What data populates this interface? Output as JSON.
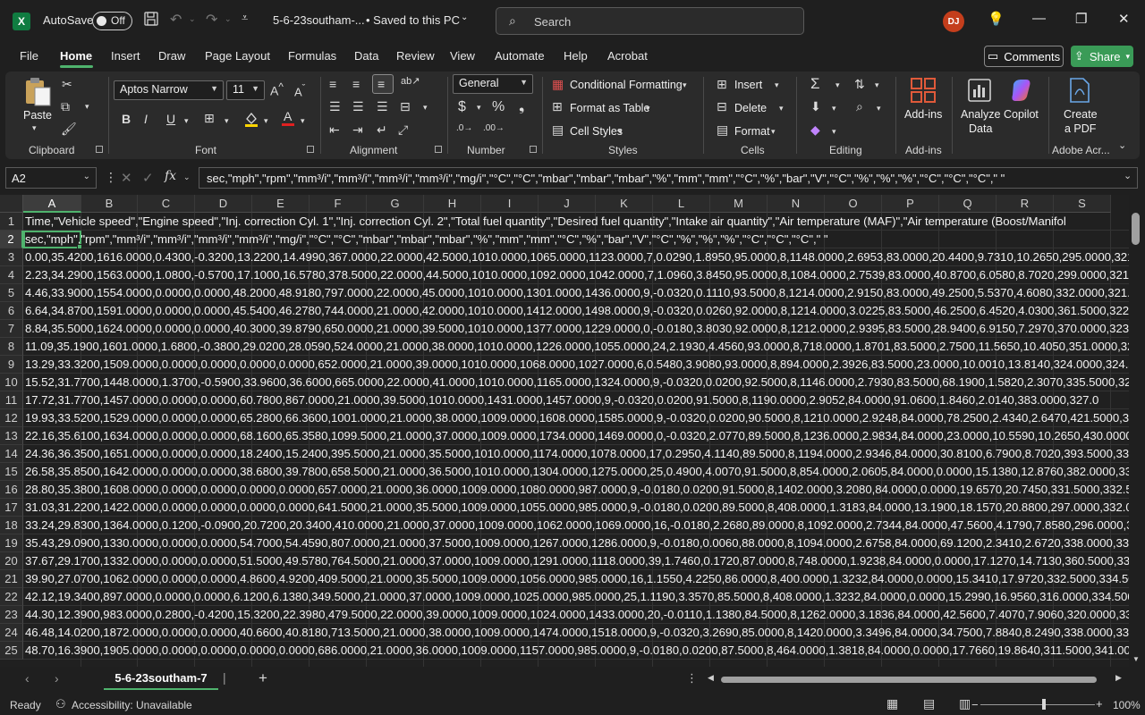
{
  "titlebar": {
    "autosave_label": "AutoSave",
    "autosave_state": "Off",
    "file_name": "5-6-23southam-...",
    "save_status": "• Saved to this PC",
    "search_placeholder": "Search",
    "user_initials": "DJ"
  },
  "tabs": [
    "File",
    "Home",
    "Insert",
    "Draw",
    "Page Layout",
    "Formulas",
    "Data",
    "Review",
    "View",
    "Automate",
    "Help",
    "Acrobat"
  ],
  "active_tab": "Home",
  "header_buttons": {
    "comments": "Comments",
    "share": "Share"
  },
  "ribbon": {
    "clipboard": {
      "paste": "Paste",
      "label": "Clipboard"
    },
    "font": {
      "name": "Aptos Narrow",
      "size": "11",
      "label": "Font"
    },
    "alignment": {
      "label": "Alignment"
    },
    "number": {
      "format": "General",
      "label": "Number"
    },
    "styles": {
      "conditional": "Conditional Formatting",
      "format_table": "Format as Table",
      "cell_styles": "Cell Styles",
      "label": "Styles"
    },
    "cells": {
      "insert": "Insert",
      "delete": "Delete",
      "format": "Format",
      "label": "Cells"
    },
    "editing": {
      "label": "Editing"
    },
    "addins": {
      "addins": "Add-ins",
      "label": "Add-ins"
    },
    "analyze": {
      "line1": "Analyze",
      "line2": "Data"
    },
    "copilot": "Copilot",
    "acrobat": {
      "line1": "Create",
      "line2": "a PDF",
      "label": "Adobe Acr..."
    }
  },
  "formula_bar": {
    "name_box": "A2",
    "fx": "fx",
    "content": "sec,\"mph\",\"rpm\",\"mm³/i\",\"mm³/i\",\"mm³/i\",\"mm³/i\",\"mg/i\",\"°C\",\"°C\",\"mbar\",\"mbar\",\"mbar\",\"%\",\"mm\",\"mm\",\"°C\",\"%\",\"bar\",\"V\",\"°C\",\"%\",\"%\",\"%\",\"°C\",\"°C\",\"°C\",\" \""
  },
  "grid": {
    "columns": [
      "A",
      "B",
      "C",
      "D",
      "E",
      "F",
      "G",
      "H",
      "I",
      "J",
      "K",
      "L",
      "M",
      "N",
      "O",
      "P",
      "Q",
      "R",
      "S"
    ],
    "row_numbers": [
      "1",
      "2",
      "3",
      "4",
      "5",
      "6",
      "7",
      "8",
      "9",
      "10",
      "11",
      "12",
      "13",
      "14",
      "15",
      "16",
      "17",
      "18",
      "19",
      "20",
      "21",
      "22",
      "23",
      "24",
      "25"
    ],
    "rows": [
      "Time,\"Vehicle speed\",\"Engine speed\",\"Inj. correction Cyl. 1\",\"Inj. correction Cyl. 2\",\"Total fuel quantity\",\"Desired fuel quantity\",\"Intake air quantity\",\"Air temperature (MAF)\",\"Air temperature (Boost/Manifol",
      "sec,\"mph\",\"rpm\",\"mm³/i\",\"mm³/i\",\"mm³/i\",\"mm³/i\",\"mg/i\",\"°C\",\"°C\",\"mbar\",\"mbar\",\"mbar\",\"%\",\"mm\",\"mm\",\"°C\",\"%\",\"bar\",\"V\",\"°C\",\"%\",\"%\",\"%\",\"°C\",\"°C\",\"°C\",\" \"",
      "0.00,35.4200,1616.0000,0.4300,-0.3200,13.2200,14.4990,367.0000,22.0000,42.5000,1010.0000,1065.0000,1123.0000,7,0.0290,1.8950,95.0000,8,1148.0000,2.6953,83.0000,20.4400,9.7310,10.2650,295.0000,321.5",
      "2.23,34.2900,1563.0000,1.0800,-0.5700,17.1000,16.5780,378.5000,22.0000,44.5000,1010.0000,1092.0000,1042.0000,7,1.0960,3.8450,95.0000,8,1084.0000,2.7539,83.0000,40.8700,6.0580,8.7020,299.0000,321.00",
      "4.46,33.9000,1554.0000,0.0000,0.0000,48.2000,48.9180,797.0000,22.0000,45.0000,1010.0000,1301.0000,1436.0000,9,-0.0320,0.1110,93.5000,8,1214.0000,2.9150,83.0000,49.2500,5.5370,4.6080,332.0000,321.50",
      "6.64,34.8700,1591.0000,0.0000,0.0000,45.5400,46.2780,744.0000,21.0000,42.0000,1010.0000,1412.0000,1498.0000,9,-0.0320,0.0260,92.0000,8,1214.0000,3.0225,83.5000,46.2500,6.4520,4.0300,361.5000,322.00",
      "8.84,35.5000,1624.0000,0.0000,0.0000,40.3000,39.8790,650.0000,21.0000,39.5000,1010.0000,1377.0000,1229.0000,0,-0.0180,3.8030,92.0000,8,1212.0000,2.9395,83.5000,28.9400,6.9150,7.2970,370.0000,323.00",
      "11.09,35.1900,1601.0000,1.6800,-0.3800,29.0200,28.0590,524.0000,21.0000,38.0000,1010.0000,1226.0000,1055.0000,24,2.1930,4.4560,93.0000,8,718.0000,1.8701,83.5000,2.7500,11.5650,10.4050,351.0000,324.",
      "13.29,33.3200,1509.0000,0.0000,0.0000,0.0000,0.0000,652.0000,21.0000,39.0000,1010.0000,1068.0000,1027.0000,6,0.5480,3.9080,93.0000,8,894.0000,2.3926,83.5000,23.0000,10.0010,13.8140,324.0000,324.500",
      "15.52,31.7700,1448.0000,1.3700,-0.5900,33.9600,36.6000,665.0000,22.0000,41.0000,1010.0000,1165.0000,1324.0000,9,-0.0320,0.0200,92.5000,8,1146.0000,2.7930,83.5000,68.1900,1.5820,2.3070,335.5000,325.5",
      "17.72,31.7700,1457.0000,0.0000,0.0000,60.7800,867.0000,21.0000,39.5000,1010.0000,1431.0000,1457.0000,9,-0.0320,0.0200,91.5000,8,1190.0000,2.9052,84.0000,91.0600,1.8460,2.0140,383.0000,327.0",
      "19.93,33.5200,1529.0000,0.0000,0.0000,65.2800,66.3600,1001.0000,21.0000,38.0000,1009.0000,1608.0000,1585.0000,9,-0.0320,0.0200,90.5000,8,1210.0000,2.9248,84.0000,78.2500,2.4340,2.6470,421.5000,329.",
      "22.16,35.6100,1634.0000,0.0000,0.0000,68.1600,65.3580,1099.5000,21.0000,37.0000,1009.0000,1734.0000,1469.0000,0,-0.0320,2.0770,89.5000,8,1236.0000,2.9834,84.0000,23.0000,10.5590,10.2650,430.0000,33",
      "24.36,36.3500,1651.0000,0.0000,0.0000,18.2400,15.2400,395.5000,21.0000,35.5000,1010.0000,1174.0000,1078.0000,17,0.2950,4.1140,89.5000,8,1194.0000,2.9346,84.0000,30.8100,6.7900,8.7020,393.5000,331.5",
      "26.58,35.8500,1642.0000,0.0000,0.0000,38.6800,39.7800,658.5000,21.0000,36.5000,1010.0000,1304.0000,1275.0000,25,0.4900,4.0070,91.5000,8,854.0000,2.0605,84.0000,0.0000,15.1380,12.8760,382.0000,332.0",
      "28.80,35.3800,1608.0000,0.0000,0.0000,0.0000,0.0000,657.0000,21.0000,36.0000,1009.0000,1080.0000,987.0000,9,-0.0180,0.0200,91.5000,8,1402.0000,3.2080,84.0000,0.0000,19.6570,20.7450,331.5000,332.500",
      "31.03,31.2200,1422.0000,0.0000,0.0000,0.0000,0.0000,641.5000,21.0000,35.5000,1009.0000,1055.0000,985.0000,9,-0.0180,0.0200,89.5000,8,408.0000,1.3183,84.0000,13.1900,18.1570,20.8800,297.0000,332.000",
      "33.24,29.8300,1364.0000,0.1200,-0.0900,20.7200,20.3400,410.0000,21.0000,37.0000,1009.0000,1062.0000,1069.0000,16,-0.0180,2.2680,89.0000,8,1092.0000,2.7344,84.0000,47.5600,4.1790,7.8580,296.0000,332",
      "35.43,29.0900,1330.0000,0.0000,0.0000,54.7000,54.4590,807.0000,21.0000,37.5000,1009.0000,1267.0000,1286.0000,9,-0.0180,0.0060,88.0000,8,1094.0000,2.6758,84.0000,69.1200,2.3410,2.6720,338.0000,333.5",
      "37.67,29.1700,1332.0000,0.0000,0.0000,51.5000,49.5780,764.5000,21.0000,37.0000,1009.0000,1291.0000,1118.0000,39,1.7460,0.1720,87.0000,8,748.0000,1.9238,84.0000,0.0000,17.1270,14.7130,360.5000,334.5",
      "39.90,27.0700,1062.0000,0.0000,0.0000,4.8600,4.9200,409.5000,21.0000,35.5000,1009.0000,1056.0000,985.0000,16,1.1550,4.2250,86.0000,8,400.0000,1.3232,84.0000,0.0000,15.3410,17.9720,332.5000,334.500",
      "42.12,19.3400,897.0000,0.0000,0.0000,6.1200,6.1380,349.5000,21.0000,37.0000,1009.0000,1025.0000,985.0000,25,1.1190,3.3570,85.5000,8,408.0000,1.3232,84.0000,0.0000,15.2990,16.9560,316.0000,334.5000,",
      "44.30,12.3900,983.0000,0.2800,-0.4200,15.3200,22.3980,479.5000,22.0000,39.0000,1009.0000,1024.0000,1433.0000,20,-0.0110,1.1380,84.5000,8,1262.0000,3.1836,84.0000,42.5600,7.4070,7.9060,320.0000,336.0",
      "46.48,14.0200,1872.0000,0.0000,0.0000,40.6600,40.8180,713.5000,21.0000,38.0000,1009.0000,1474.0000,1518.0000,9,-0.0320,3.2690,85.0000,8,1420.0000,3.3496,84.0000,34.7500,7.8840,8.2490,338.0000,339.0",
      "48.70,16.3900,1905.0000,0.0000,0.0000,0.0000,0.0000,686.0000,21.0000,36.0000,1009.0000,1157.0000,985.0000,9,-0.0180,0.0200,87.5000,8,464.0000,1.3818,84.0000,0.0000,17.7660,19.8640,311.5000,341.0000"
    ]
  },
  "sheet_tab": "5-6-23southam-7",
  "status": {
    "ready": "Ready",
    "accessibility": "Accessibility: Unavailable",
    "zoom": "100%"
  }
}
